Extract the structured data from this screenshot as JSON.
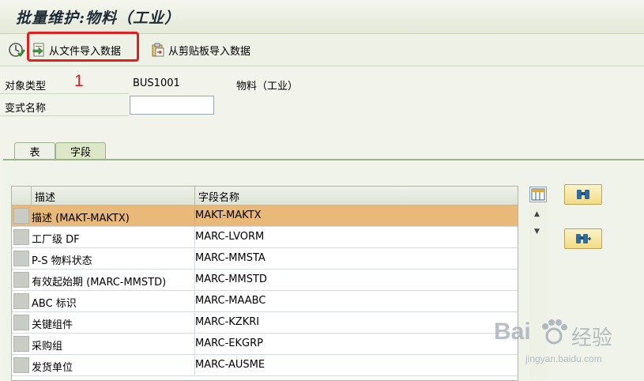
{
  "window": {
    "title": "批量维护:物料（工业）"
  },
  "toolbar": {
    "import_file_label": "从文件导入数据",
    "import_clipboard_label": "从剪贴板导入数据"
  },
  "annotation": {
    "step_number": "1",
    "highlight_color": "#e02020"
  },
  "form": {
    "object_type_label": "对象类型",
    "object_type_code": "BUS1001",
    "object_type_desc": "物料（工业）",
    "variant_name_label": "变式名称",
    "variant_name_value": ""
  },
  "tabs": [
    {
      "label": "表",
      "active": false
    },
    {
      "label": "字段",
      "active": true
    }
  ],
  "table": {
    "columns": [
      "描述",
      "字段名称"
    ],
    "rows": [
      {
        "desc": "描述 (MAKT-MAKTX)",
        "field": "MAKT-MAKTX",
        "selected": true
      },
      {
        "desc": "工厂级 DF",
        "field": "MARC-LVORM",
        "selected": false
      },
      {
        "desc": "P-S 物料状态",
        "field": "MARC-MMSTA",
        "selected": false
      },
      {
        "desc": "有效起始期 (MARC-MMSTD)",
        "field": "MARC-MMSTD",
        "selected": false
      },
      {
        "desc": "ABC 标识",
        "field": "MARC-MAABC",
        "selected": false
      },
      {
        "desc": "关键组件",
        "field": "MARC-KZKRI",
        "selected": false
      },
      {
        "desc": "采购组",
        "field": "MARC-EKGRP",
        "selected": false
      },
      {
        "desc": "发货单位",
        "field": "MARC-AUSME",
        "selected": false
      }
    ],
    "selected_color": "#e8b978"
  },
  "side_buttons": [
    {
      "icon": "binoculars-icon"
    },
    {
      "icon": "binoculars-next-icon"
    }
  ],
  "watermark": {
    "brand": "Bai",
    "brand_suffix": "经验",
    "url": "jingyan.baidu.com"
  }
}
